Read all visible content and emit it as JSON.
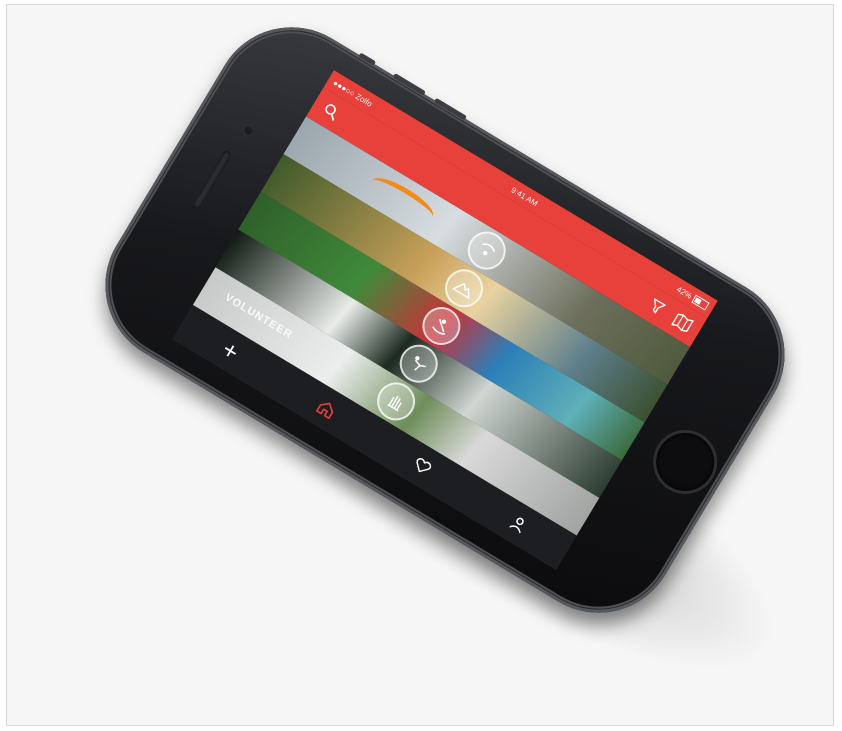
{
  "status_bar": {
    "carrier": "●●●○○ Zolfo",
    "time": "9:41 AM",
    "battery": "42%"
  },
  "colors": {
    "brand": "#e8413c",
    "active_tab": "#e8413c",
    "tab_inactive": "#ffffff"
  },
  "top_bar": {
    "left_icon": "search-icon",
    "right_icons": [
      "filter-icon",
      "map-icon"
    ]
  },
  "activities": [
    {
      "name": "paragliding",
      "icon": "paragliding-icon"
    },
    {
      "name": "hiking",
      "icon": "mountain-icon"
    },
    {
      "name": "rafting",
      "icon": "rafting-icon"
    },
    {
      "name": "diving",
      "icon": "diver-icon"
    },
    {
      "name": "volunteering",
      "icon": "hand-icon"
    }
  ],
  "volunteer_shirt_text": "VOLUNTEER",
  "tab_bar": {
    "tabs": [
      {
        "name": "add",
        "icon": "plus-icon"
      },
      {
        "name": "home",
        "icon": "home-icon",
        "active": true
      },
      {
        "name": "favorites",
        "icon": "heart-icon"
      },
      {
        "name": "profile",
        "icon": "user-icon"
      }
    ]
  }
}
